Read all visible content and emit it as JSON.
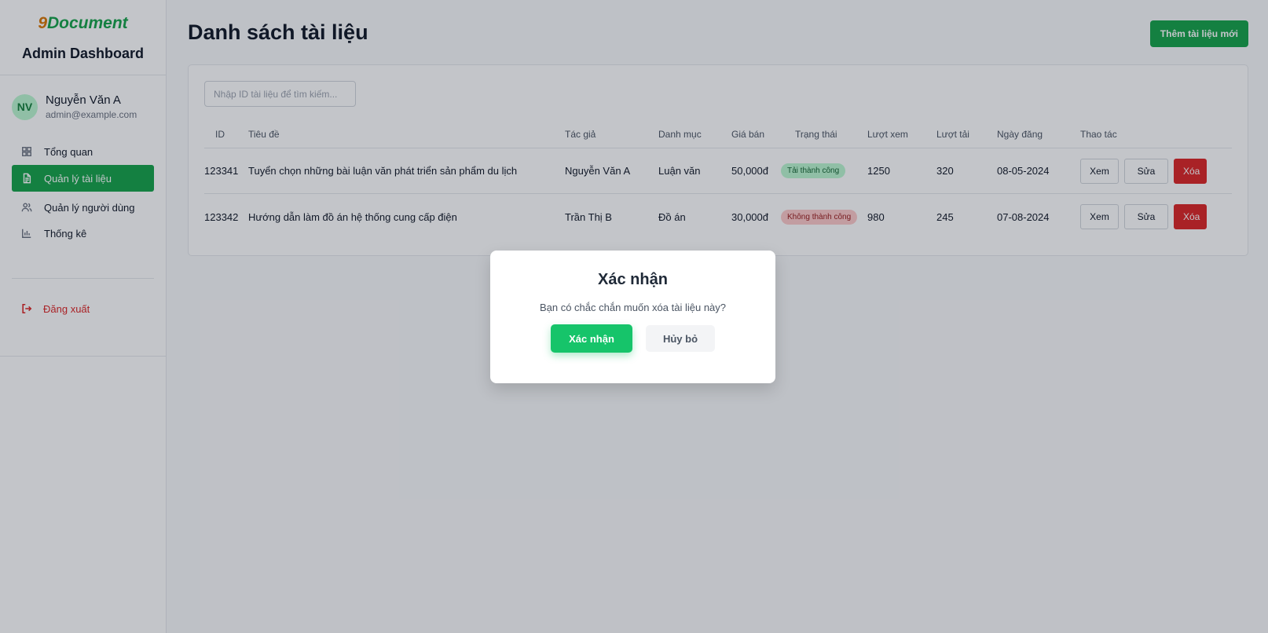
{
  "sidebar": {
    "logo_nine": "9",
    "logo_rest": "Document",
    "title": "Admin Dashboard",
    "user": {
      "initials": "NV",
      "name": "Nguyễn Văn A",
      "email": "admin@example.com"
    },
    "items": [
      {
        "label": "Tổng quan",
        "icon": "dashboard-icon"
      },
      {
        "label": "Quản lý tài liệu",
        "icon": "document-icon",
        "active": true
      },
      {
        "label": "Quản lý người dùng",
        "icon": "users-icon"
      },
      {
        "label": "Thống kê",
        "icon": "bar-chart-icon"
      }
    ],
    "logout": "Đăng xuất"
  },
  "header": {
    "title": "Danh sách tài liệu",
    "add_button": "Thêm tài liệu mới"
  },
  "search": {
    "placeholder": "Nhập ID tài liệu để tìm kiếm..."
  },
  "table": {
    "columns": [
      "ID",
      "Tiêu đề",
      "Tác giả",
      "Danh mục",
      "Giá bán",
      "Trạng thái",
      "Lượt xem",
      "Lượt tải",
      "Ngày đăng",
      "Thao tác"
    ],
    "rows": [
      {
        "id": "123341",
        "title": "Tuyển chọn những bài luận văn phát triển sản phẩm du lịch",
        "author": "Nguyễn Văn A",
        "category": "Luận văn",
        "price": "50,000đ",
        "status": "Tải thành công",
        "views": "1250",
        "downloads": "320",
        "date": "08-05-2024"
      },
      {
        "id": "123342",
        "title": "Hướng dẫn làm đồ án hệ thống cung cấp điện",
        "author": "Trần Thị B",
        "category": "Đồ án",
        "price": "30,000đ",
        "status": "Không thành công",
        "views": "980",
        "downloads": "245",
        "date": "07-08-2024"
      }
    ],
    "actions": {
      "view": "Xem",
      "edit": "Sửa",
      "delete": "Xóa"
    }
  },
  "modal": {
    "title": "Xác nhận",
    "message": "Bạn có chắc chắn muốn xóa tài liệu này?",
    "confirm": "Xác nhận",
    "cancel": "Hủy bỏ"
  },
  "colors": {
    "accent": "#16a34a",
    "danger": "#dc2626",
    "logo_nine": "#d97706"
  }
}
